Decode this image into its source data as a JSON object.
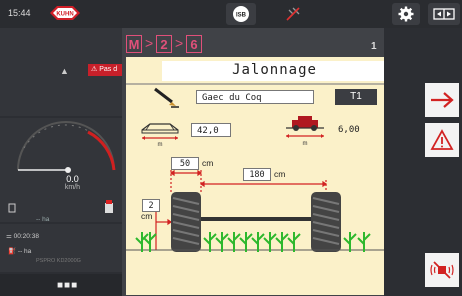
{
  "status_bar": {
    "time": "15:44",
    "logo_text": "KUHN",
    "isobus_label": "ISB",
    "icons": [
      "gps-signal-icon",
      "gear-icon",
      "fullscreen-icon"
    ]
  },
  "left_panel": {
    "alert_label": "Pas d",
    "speed_value": "0.0",
    "speed_unit": "km/h",
    "counter_1": "-- ha",
    "timer": "00:20:38",
    "counter_2": "-- ha",
    "device_info": "PSPRO KD2000G",
    "more_label": "■■■"
  },
  "breadcrumb": {
    "items": [
      "M",
      "2",
      "6"
    ],
    "separator": ">"
  },
  "page_number": "1",
  "dialog": {
    "title": "Jalonnage",
    "farm_name": "Gaec du Coq",
    "tramline_button": "T1",
    "sprayer_width": "42,0",
    "sprayer_unit": "m",
    "tool_width": "6,00",
    "tool_unit": "m",
    "track_gap": "50",
    "track_gap_unit": "cm",
    "track_distance": "180",
    "track_distance_unit": "cm",
    "track_offset": "2",
    "track_offset_unit": "cm"
  },
  "colors": {
    "accent_pink": "#e0507a",
    "dialog_bg": "#fbf1c9",
    "alert_red": "#c8202a",
    "dim_red": "#d22222",
    "plant_green": "#2db82d"
  }
}
